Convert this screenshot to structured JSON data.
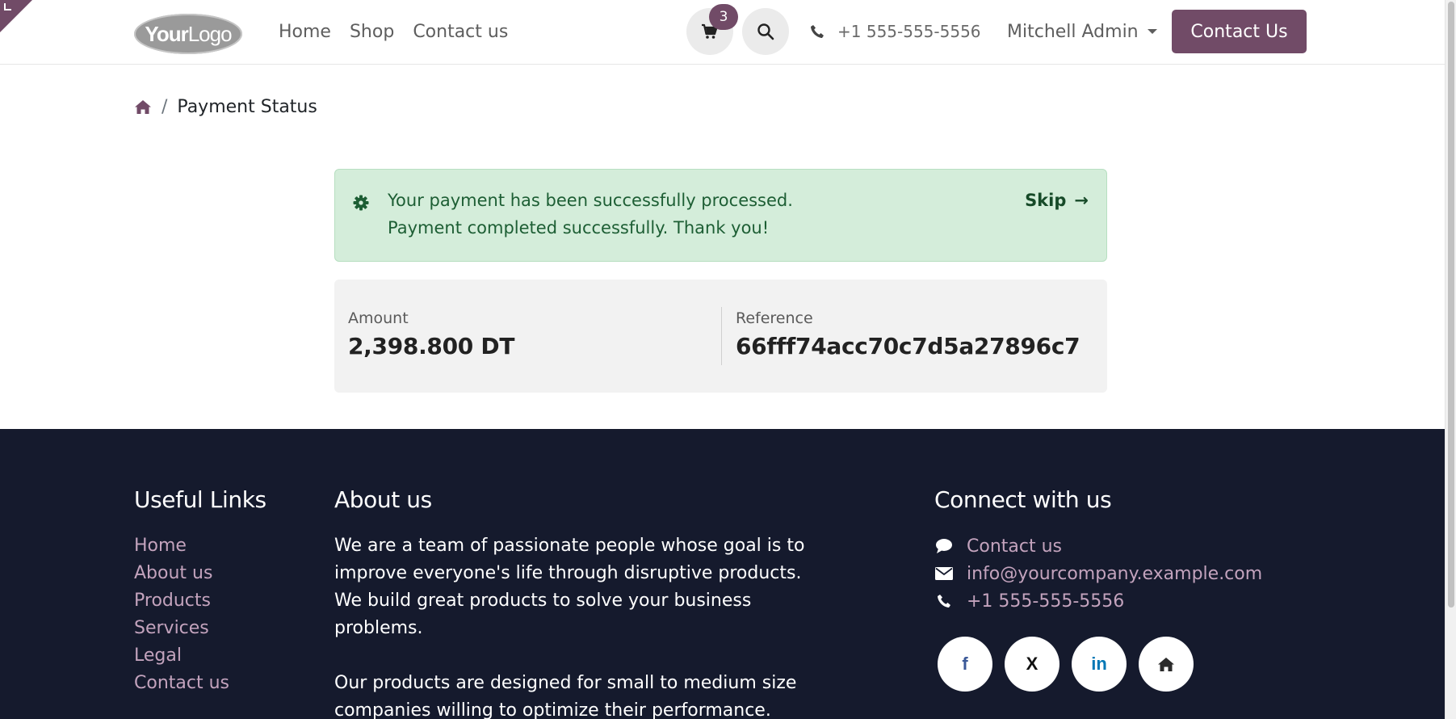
{
  "header": {
    "logo": {
      "bold": "Your",
      "light": "Logo"
    },
    "nav": [
      "Home",
      "Shop",
      "Contact us"
    ],
    "cart": {
      "count": "3",
      "icon": "cart-icon"
    },
    "search": {
      "icon": "search-icon"
    },
    "phone": "+1 555-555-5556",
    "user": "Mitchell Admin",
    "cta_label": "Contact Us"
  },
  "breadcrumb": {
    "home_icon": "home-icon",
    "current": "Payment Status"
  },
  "alert": {
    "line1": "Your payment has been successfully processed.",
    "line2": "Payment completed successfully. Thank you!",
    "skip_label": "Skip",
    "skip_arrow": "→",
    "icon": "gear-icon"
  },
  "details": {
    "amount_label": "Amount",
    "amount_value": "2,398.800 DT",
    "reference_label": "Reference",
    "reference_value": "66fff74acc70c7d5a27896c7"
  },
  "footer": {
    "useful_links_title": "Useful Links",
    "useful_links": [
      "Home",
      "About us",
      "Products",
      "Services",
      "Legal",
      "Contact us"
    ],
    "about_title": "About us",
    "about_lines": [
      "We are a team of passionate people whose goal is to",
      "improve everyone's life through disruptive products.",
      "We build great products to solve your business",
      "problems.",
      "Our products are designed for small to medium size",
      "companies willing to optimize their performance."
    ],
    "connect_title": "Connect with us",
    "connect": {
      "contact": "Contact us",
      "email": "info@yourcompany.example.com",
      "phone": "+1 555-555-5556"
    },
    "social": [
      {
        "name": "facebook",
        "glyph": "f",
        "color": "#3b5998"
      },
      {
        "name": "x",
        "glyph": "X",
        "color": "#111111"
      },
      {
        "name": "linkedin",
        "glyph": "in",
        "color": "#0077b5"
      },
      {
        "name": "home",
        "glyph": "",
        "color": "#2b2b2b"
      }
    ]
  },
  "colors": {
    "brand": "#714b67",
    "footer_bg": "#151a2d",
    "footer_link": "#c3a3bd",
    "alert_bg": "#d4edda",
    "alert_text": "#1d5e34"
  }
}
